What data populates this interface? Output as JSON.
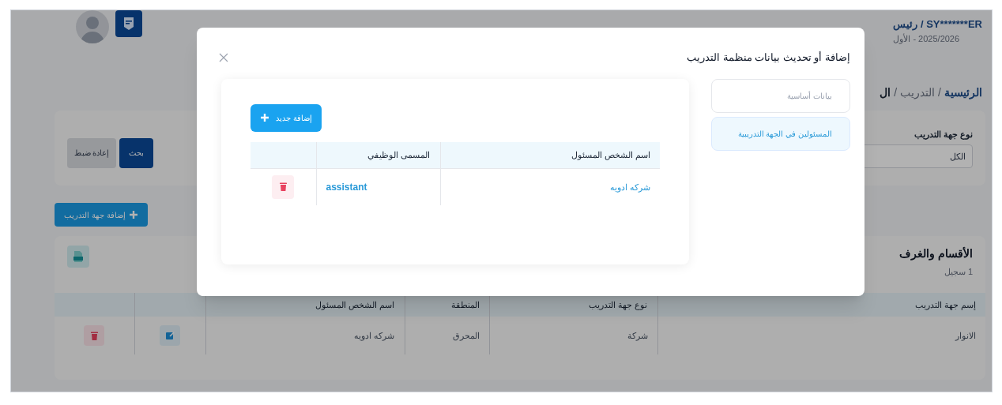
{
  "header": {
    "user": "SY*******ER / رئيس",
    "term": "2025/2026 - الأول"
  },
  "breadcrumb": {
    "separator": "/",
    "items": [
      {
        "label": "الرئيسية",
        "current": false
      },
      {
        "label": "التدريب",
        "current": false
      },
      {
        "label": "ال",
        "current": true
      }
    ]
  },
  "filters": {
    "label": "نوع جهة التدريب",
    "value": "الكل",
    "buttons": [
      {
        "label": "بحث",
        "kind": "primary"
      },
      {
        "label": "إعادة ضبط",
        "kind": "secondary"
      }
    ]
  },
  "add_button": "إضافة جهة التدريب",
  "section": {
    "title": "الأقسام والغرف",
    "count": "1 سجيل",
    "columns": [
      "إسم جهة التدريب",
      "نوع جهة التدريب",
      "المنطقة",
      "اسم الشخص المسئول"
    ],
    "rows": [
      {
        "cells": [
          "الانوار",
          "شركة",
          "المحرق",
          "شركه ادويه"
        ]
      }
    ]
  },
  "modal": {
    "title": "إضافة أو تحديث بيانات منظمة التدريب",
    "tabs": [
      {
        "label": "بيانات أساسية",
        "selected": false
      },
      {
        "label": "المسئولين في الجهة التدريبية",
        "selected": true
      }
    ],
    "add_button": "إضافة جديد",
    "columns": [
      "اسم الشخص المسئول",
      "المسمى الوظيفي"
    ],
    "rows": [
      {
        "name": "شركه ادويه",
        "job_title": "assistant"
      }
    ]
  }
}
